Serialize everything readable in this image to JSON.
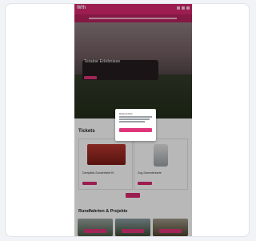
{
  "site": {
    "logo": "Wfh",
    "hero_title": "Teraine Erlebnisse",
    "hero_subtitle": "",
    "hero_button": ""
  },
  "sections": {
    "tickets_title": "Tickets",
    "tours_title": "Rundfahrten & Projekte"
  },
  "tickets": [
    {
      "label": "Dampflok-Sonderfahrt Kl.",
      "price": ""
    },
    {
      "label": "Zug-Sammlerkarte",
      "price": ""
    }
  ],
  "cookie_modal": {
    "title": "Datenschutz",
    "accept": "",
    "link_left": "",
    "link_right": ""
  },
  "colors": {
    "brand": "#d8296f",
    "brand_dark": "#b8235f"
  }
}
